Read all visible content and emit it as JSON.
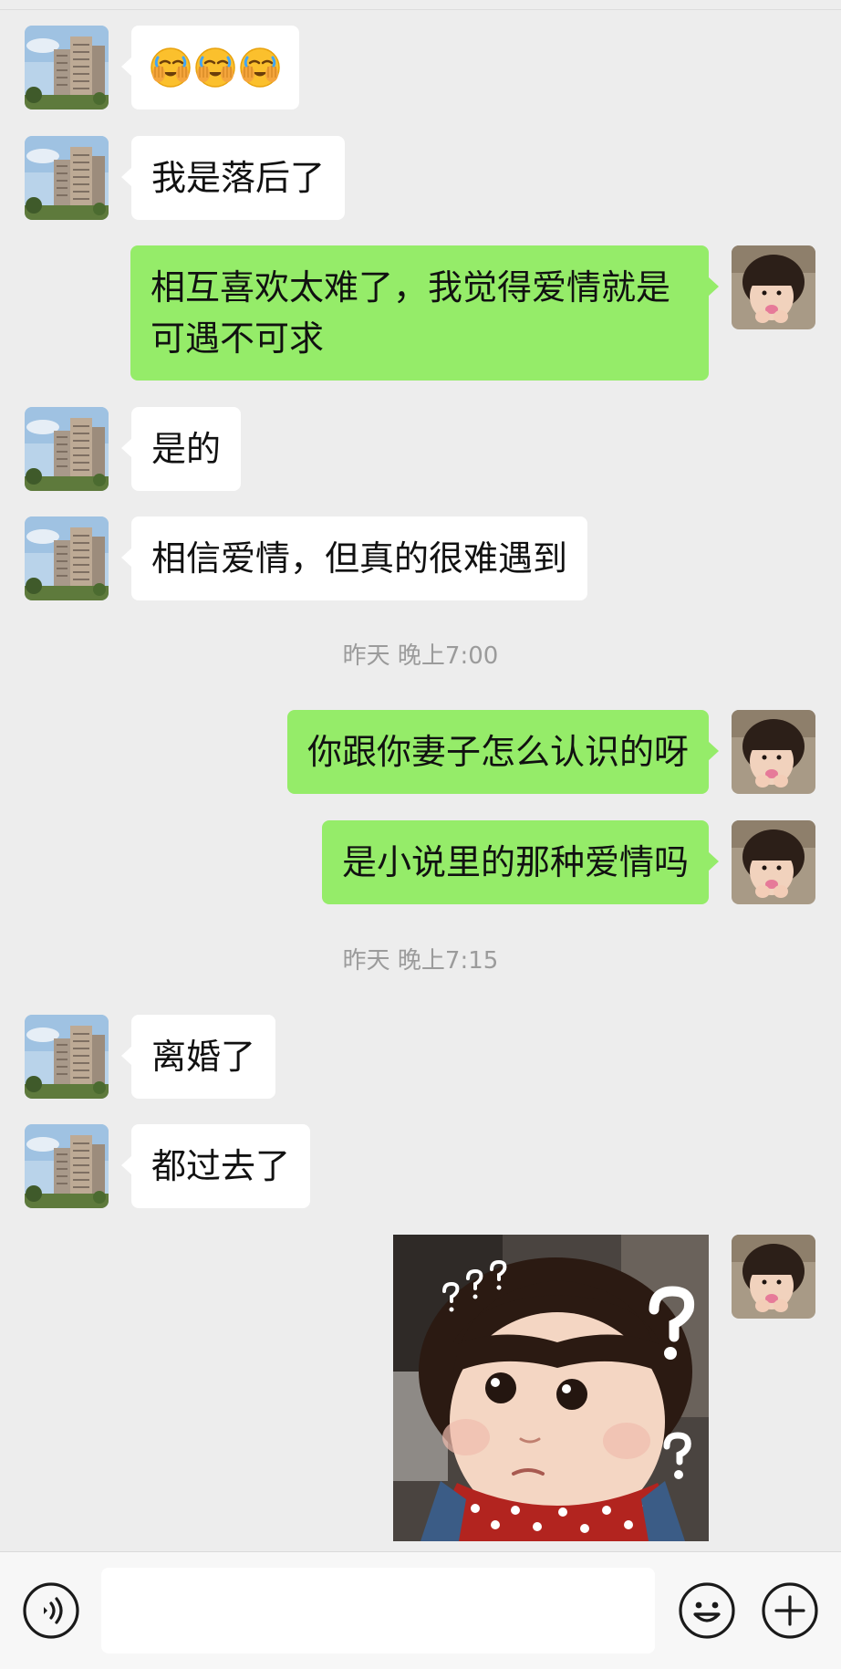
{
  "messages": {
    "m1_emojis": [
      "face-in-hands-emoji",
      "face-in-hands-emoji",
      "face-in-hands-emoji"
    ],
    "m2": "我是落后了",
    "m3": "相互喜欢太难了，我觉得爱情就是可遇不可求",
    "m4": "是的",
    "m5": "相信爱情，但真的很难遇到",
    "t1": "昨天 晚上7:00",
    "m6": "你跟你妻子怎么认识的呀",
    "m7": "是小说里的那种爱情吗",
    "t2": "昨天 晚上7:15",
    "m8": "离婚了",
    "m9": "都过去了",
    "m10_sticker": "confused-baby-sticker"
  },
  "input_bar": {
    "voice_icon": "voice-icon",
    "text_value": "",
    "emoji_icon": "emoji-icon",
    "add_icon": "plus-icon"
  },
  "colors": {
    "background": "#ededed",
    "outgoing_bubble": "#95ec69",
    "incoming_bubble": "#ffffff",
    "timestamp_text": "#9b9b9b",
    "input_bar": "#f7f7f7"
  }
}
